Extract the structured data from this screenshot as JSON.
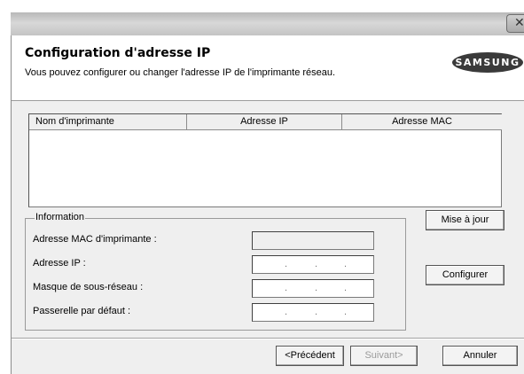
{
  "window": {
    "close_glyph": "✕"
  },
  "header": {
    "title": "Configuration d'adresse IP",
    "subtitle": "Vous pouvez configurer ou changer l'adresse IP de l'imprimante réseau.",
    "logo_text": "SAMSUNG"
  },
  "printer_list": {
    "columns": [
      "Nom d'imprimante",
      "Adresse IP",
      "Adresse MAC"
    ],
    "rows": []
  },
  "information": {
    "legend": "Information",
    "mac_label": "Adresse MAC d'imprimante :",
    "mac_value": "",
    "ip_label": "Adresse IP :",
    "ip_value": "",
    "mask_label": "Masque de sous-réseau :",
    "mask_value": "",
    "gateway_label": "Passerelle par défaut :",
    "gateway_value": ""
  },
  "buttons": {
    "refresh": "Mise à jour",
    "configure": "Configurer",
    "previous": "<Précédent",
    "next": "Suivant>",
    "cancel": "Annuler"
  }
}
